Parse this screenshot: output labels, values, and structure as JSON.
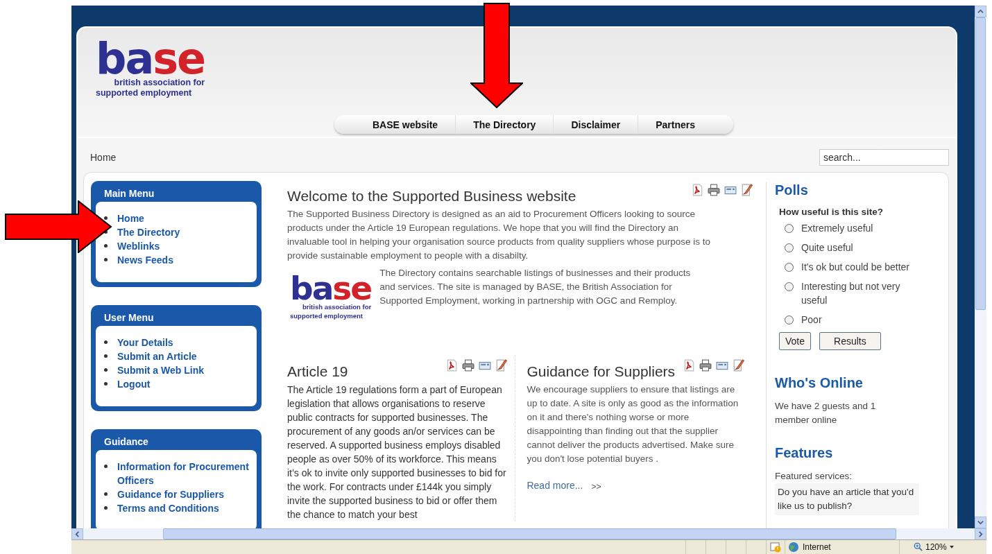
{
  "logo": {
    "letters_left": "ba",
    "letters_right": "se",
    "tagline_1": "british association for",
    "tagline_2": "supported employment"
  },
  "nav": [
    {
      "label": "BASE website",
      "selected": false
    },
    {
      "label": "The Directory",
      "selected": false
    },
    {
      "label": "Disclaimer",
      "selected": false
    },
    {
      "label": "Partners",
      "selected": false
    }
  ],
  "breadcrumb": "Home",
  "search": {
    "placeholder": "search..."
  },
  "menus": [
    {
      "title": "Main Menu",
      "items": [
        "Home",
        "The Directory",
        "Weblinks",
        "News Feeds"
      ]
    },
    {
      "title": "User Menu",
      "items": [
        "Your Details",
        "Submit an Article",
        "Submit a Web Link",
        "Logout"
      ]
    },
    {
      "title": "Guidance",
      "items": [
        "Information for Procurement Officers",
        "Guidance for Suppliers",
        "Terms and Conditions"
      ]
    }
  ],
  "welcome": {
    "title": "Welcome to the Supported Business website",
    "text": "The Supported Business Directory is designed as an aid to Procurement Officers looking to source products under the Article 19 European regulations. We hope that you will find the Directory an invaluable tool in helping your organisation source products from quality suppliers whose purpose is to provide sustainable employment to people with a disabilty.",
    "logo": {
      "letters_left": "ba",
      "letters_right": "se",
      "tagline_1": "british association for",
      "tagline_2": "supported employment"
    },
    "text_2": "The Directory contains searchable listings of businesses  and  their products and services. The site is managed  by BASE, the British Association for Supported Employment, working in partnership with OGC and Remploy."
  },
  "articles": [
    {
      "title": "Article 19",
      "text": "The Article 19 regulations form a part of European legislation that allows organisations to reserve public contracts for supported businesses.  The procurement of any goods an/or services can be reserved. A supported business employs disabled people as over 50% of its workforce. This means it’s ok to invite only supported businesses to bid for the work. For contracts under £144k you simply invite the supported business to bid or offer them the chance to match your best"
    },
    {
      "title": "Guidance for Suppliers",
      "text": "We encourage suppliers to ensure that listings are up to date. A site is only as good as the information on it and there's nothing worse or more disappointing than finding out that the supplier cannot deliver the products advertised. Make sure you don't lose potential buyers .",
      "read_more": "Read more...",
      "read_more_arrows": ">>"
    }
  ],
  "polls": {
    "title": "Polls",
    "question": "How useful is this site?",
    "options": [
      {
        "label": "Extremely useful",
        "selected": false
      },
      {
        "label": "Quite useful",
        "selected": false
      },
      {
        "label": "It's ok but could be better",
        "selected": false
      },
      {
        "label": "Interesting but not very useful",
        "selected": false
      },
      {
        "label": "Poor",
        "selected": false
      }
    ],
    "buttons": [
      "Vote",
      "Results"
    ]
  },
  "whos_online": {
    "title": "Who's Online",
    "text": "We have 2 guests and 1 member  online"
  },
  "features": {
    "title": "Features",
    "label": "Featured services:",
    "item": "Do you have an article that you'd like us to publish?"
  },
  "status_bar": {
    "zone": "Internet",
    "zoom": "120%"
  }
}
